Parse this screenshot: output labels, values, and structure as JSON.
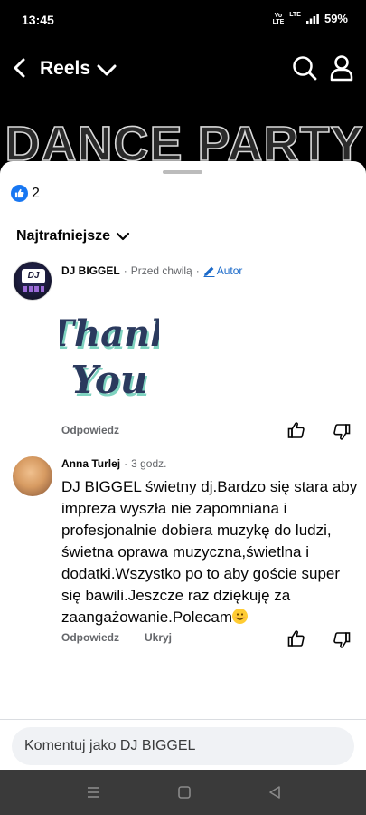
{
  "status": {
    "time": "13:45",
    "volte_top": "Vo",
    "volte_bottom": "LTE",
    "lte": "LTE",
    "battery": "59%"
  },
  "header": {
    "title": "Reels"
  },
  "banner": {
    "text": "DANCE PARTY"
  },
  "reactions": {
    "count": "2"
  },
  "sort": {
    "label": "Najtrafniejsze"
  },
  "comments": [
    {
      "author": "DJ BIGGEL",
      "time": "Przed chwilą",
      "badge": "Autor",
      "sticker": {
        "line1": "Thank",
        "line2": "You"
      },
      "avatar_text": "DJ",
      "actions": [
        "Odpowiedz"
      ]
    },
    {
      "author": "Anna Turlej",
      "time": "3 godz.",
      "text": "DJ BIGGEL świetny dj.Bardzo się stara aby impreza wyszła nie zapomniana i profesjonalnie dobiera muzykę do ludzi, świetna oprawa muzyczna,świetlna i dodatki.Wszystko po to aby goście super się bawili.Jeszcze raz dziękuję za zaangażowanie.Polecam",
      "actions": [
        "Odpowiedz",
        "Ukryj"
      ]
    }
  ],
  "composer": {
    "placeholder": "Komentuj jako DJ BIGGEL"
  },
  "colors": {
    "accent": "#1877f2",
    "author_badge": "#1b6ac9",
    "muted": "#65676b",
    "navbar": "#3a3a3a"
  }
}
